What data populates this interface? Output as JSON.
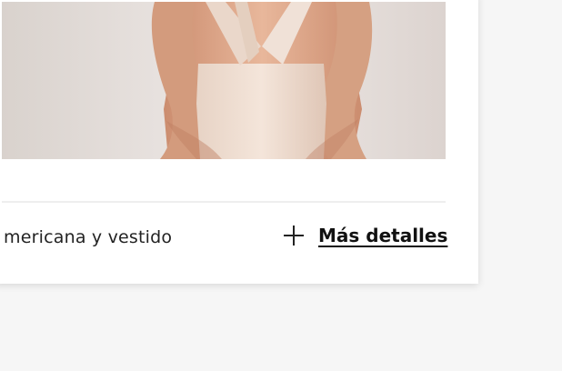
{
  "product": {
    "image_description": "",
    "description": "mericana y vestido",
    "details_label": "Más detalles",
    "plus_icon": "plus-icon"
  },
  "colors": {
    "background": "#f6f6f6",
    "card": "#ffffff",
    "text": "#222222"
  }
}
